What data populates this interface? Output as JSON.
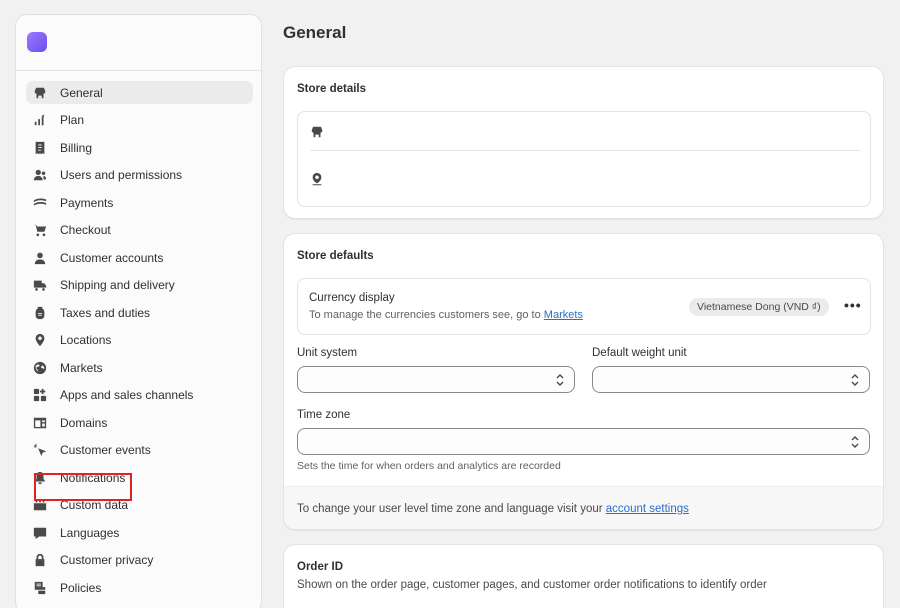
{
  "sidebar": {
    "items": [
      {
        "label": "General",
        "icon": "store-icon"
      },
      {
        "label": "Plan",
        "icon": "plan-icon"
      },
      {
        "label": "Billing",
        "icon": "billing-icon"
      },
      {
        "label": "Users and permissions",
        "icon": "users-icon"
      },
      {
        "label": "Payments",
        "icon": "payments-icon"
      },
      {
        "label": "Checkout",
        "icon": "cart-icon"
      },
      {
        "label": "Customer accounts",
        "icon": "person-icon"
      },
      {
        "label": "Shipping and delivery",
        "icon": "truck-icon"
      },
      {
        "label": "Taxes and duties",
        "icon": "tax-icon"
      },
      {
        "label": "Locations",
        "icon": "location-icon"
      },
      {
        "label": "Markets",
        "icon": "globe-icon"
      },
      {
        "label": "Apps and sales channels",
        "icon": "apps-icon"
      },
      {
        "label": "Domains",
        "icon": "domains-icon"
      },
      {
        "label": "Customer events",
        "icon": "cursor-icon"
      },
      {
        "label": "Notifications",
        "icon": "bell-icon"
      },
      {
        "label": "Custom data",
        "icon": "data-icon"
      },
      {
        "label": "Languages",
        "icon": "language-icon"
      },
      {
        "label": "Customer privacy",
        "icon": "lock-icon"
      },
      {
        "label": "Policies",
        "icon": "policy-icon"
      }
    ]
  },
  "page": {
    "title": "General"
  },
  "store_details": {
    "title": "Store details"
  },
  "store_defaults": {
    "title": "Store defaults",
    "currency_label": "Currency display",
    "currency_desc": "To manage the currencies customers see, go to",
    "currency_link": "Markets",
    "currency_value": "Vietnamese Dong (VND ₫)",
    "more_actions": "•••",
    "unit_system_label": "Unit system",
    "unit_system_value": "",
    "weight_unit_label": "Default weight unit",
    "weight_unit_value": "",
    "timezone_label": "Time zone",
    "timezone_value": "",
    "timezone_help": "Sets the time for when orders and analytics are recorded",
    "footer_text": "To change your user level time zone and language visit your",
    "footer_link": "account settings"
  },
  "order_id": {
    "title": "Order ID",
    "desc": "Shown on the order page, customer pages, and customer order notifications to identify order"
  },
  "colors": {
    "highlight": "#e02424",
    "link": "#2c6ecb",
    "accent": "#7c5cff"
  }
}
